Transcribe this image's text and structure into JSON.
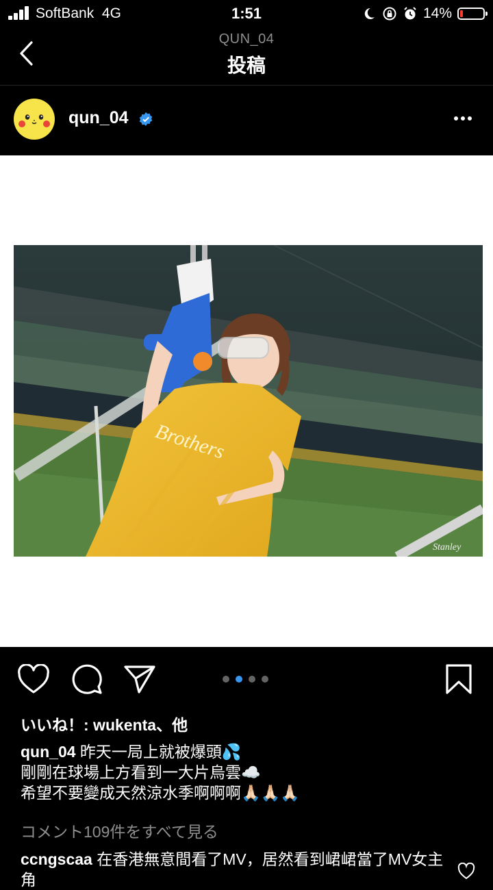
{
  "status": {
    "carrier": "SoftBank",
    "network": "4G",
    "time": "1:51",
    "battery_percent": "14%",
    "battery_level": 0.14,
    "icons": [
      "moon-icon",
      "rotation-lock-icon",
      "alarm-icon"
    ]
  },
  "nav": {
    "subtitle": "QUN_04",
    "title": "投稿"
  },
  "post": {
    "username": "qun_04",
    "verified": true,
    "photo_watermark": "Stanley",
    "shirt_text": "Brothers",
    "carousel": {
      "count": 4,
      "active_index": 1
    }
  },
  "likes_text": "いいね！: wukenta、他",
  "caption": {
    "username": "qun_04",
    "lines": [
      "昨天一局上就被爆頭💦",
      "剛剛在球場上方看到一大片烏雲☁️",
      "希望不要變成天然涼水季啊啊啊🙏🏻🙏🏻🙏🏻"
    ]
  },
  "view_all_comments": "コメント109件をすべて見る",
  "comment": {
    "username": "ccngscaa",
    "text": "在香港無意間看了MV，居然看到峮峮當了MV女主角"
  },
  "colors": {
    "background": "#000000",
    "accent_blue": "#3897f0",
    "muted": "#8e8e8e",
    "verified": "#3897f0"
  }
}
